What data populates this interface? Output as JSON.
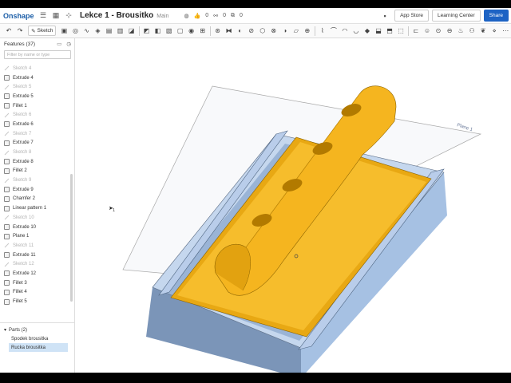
{
  "topbar": {
    "brand": "Onshape",
    "doc_title": "Lekce 1 - Brousitko",
    "branch": "Main",
    "likes": "0",
    "links": "0",
    "copies": "0",
    "app_store": "App Store",
    "learning_center": "Learning Center",
    "share": "Share"
  },
  "toolbar": {
    "sketch_label": "Sketch"
  },
  "features": {
    "header": "Features (37)",
    "filter_placeholder": "Filter by name or type",
    "items": [
      {
        "label": "Sketch 4",
        "dim": true
      },
      {
        "label": "Extrude 4",
        "dim": false
      },
      {
        "label": "Sketch 5",
        "dim": true
      },
      {
        "label": "Extrude 5",
        "dim": false
      },
      {
        "label": "Fillet 1",
        "dim": false
      },
      {
        "label": "Sketch 6",
        "dim": true
      },
      {
        "label": "Extrude 6",
        "dim": false
      },
      {
        "label": "Sketch 7",
        "dim": true
      },
      {
        "label": "Extrude 7",
        "dim": false
      },
      {
        "label": "Sketch 8",
        "dim": true
      },
      {
        "label": "Extrude 8",
        "dim": false
      },
      {
        "label": "Fillet 2",
        "dim": false
      },
      {
        "label": "Sketch 9",
        "dim": true
      },
      {
        "label": "Extrude 9",
        "dim": false
      },
      {
        "label": "Chamfer 2",
        "dim": false
      },
      {
        "label": "Linear pattern 1",
        "dim": false
      },
      {
        "label": "Sketch 10",
        "dim": true
      },
      {
        "label": "Extrude 10",
        "dim": false
      },
      {
        "label": "Plane 1",
        "dim": false
      },
      {
        "label": "Sketch 11",
        "dim": true
      },
      {
        "label": "Extrude 11",
        "dim": false
      },
      {
        "label": "Sketch 12",
        "dim": true
      },
      {
        "label": "Extrude 12",
        "dim": false
      },
      {
        "label": "Fillet 3",
        "dim": false
      },
      {
        "label": "Fillet 4",
        "dim": false
      },
      {
        "label": "Fillet 5",
        "dim": false
      }
    ]
  },
  "parts": {
    "header": "Parts (2)",
    "items": [
      {
        "label": "Spodek brousitka",
        "selected": false
      },
      {
        "label": "Rucka brousitka",
        "selected": true
      }
    ]
  },
  "viewport": {
    "plane_label": "Plane 1",
    "cursor_label": "1"
  },
  "colors": {
    "accent": "#1d63c4",
    "handle": "#f2b420",
    "base": "#a9c3e4"
  }
}
